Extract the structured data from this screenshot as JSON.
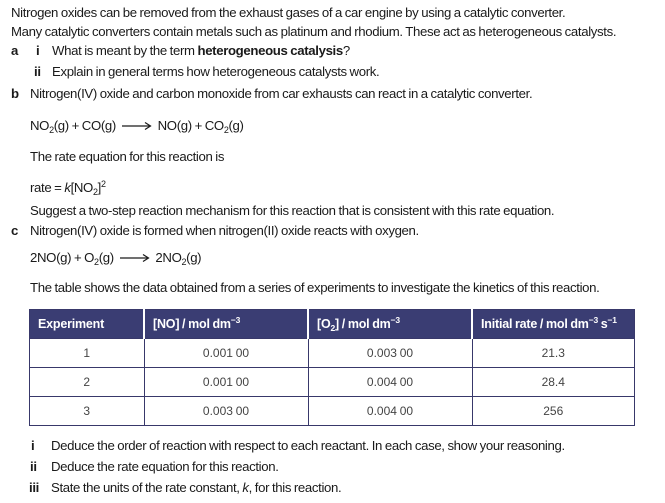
{
  "intro": {
    "line1": "Nitrogen oxides can be removed from the exhaust gases of a car engine by using a catalytic converter.",
    "line2": "Many catalytic converters contain metals such as platinum and rhodium. These act as heterogeneous catalysts."
  },
  "part_a": {
    "label": "a",
    "sub_i": {
      "label": "i",
      "text_before": "What is meant by the term ",
      "text_bold": "heterogeneous catalysis",
      "text_after": "?"
    },
    "sub_ii": {
      "label": "ii",
      "text": "Explain in general terms how heterogeneous catalysts work."
    }
  },
  "part_b": {
    "label": "b",
    "text": "Nitrogen(IV) oxide and carbon monoxide from car exhausts can react in a catalytic converter.",
    "equation": {
      "r1_a": "NO",
      "r1_sub": "2",
      "r1_b": "(g) + CO(g)",
      "p_a": "NO(g) + CO",
      "p_sub": "2",
      "p_b": "(g)"
    },
    "rate_intro": "The rate equation for this reaction is",
    "rate_eq": {
      "prefix": "rate = ",
      "k": "k",
      "bracket_open": "[NO",
      "sub": "2",
      "bracket_close": "]",
      "sup": "2"
    },
    "question": "Suggest a two-step reaction mechanism for this reaction that is consistent with this rate equation."
  },
  "part_c": {
    "label": "c",
    "text": "Nitrogen(IV) oxide is formed when nitrogen(II) oxide reacts with oxygen.",
    "equation": {
      "r_a": "2NO(g) + O",
      "r_sub": "2",
      "r_b": "(g)",
      "p_a": "2NO",
      "p_sub": "2",
      "p_b": "(g)"
    },
    "table_intro": "The table shows the data obtained from a series of experiments to investigate the kinetics of this reaction.",
    "table": {
      "headers": {
        "experiment": "Experiment",
        "no_a": "[NO] / mol dm",
        "no_sup": "−3",
        "o2_a": "[O",
        "o2_sub": "2",
        "o2_b": "] / mol dm",
        "o2_sup": "−3",
        "rate_a": "Initial rate / mol  dm",
        "rate_sup1": "−3",
        "rate_b": " s",
        "rate_sup2": "−1"
      },
      "rows": [
        {
          "experiment": "1",
          "no": "0.001 00",
          "o2": "0.003 00",
          "rate": "21.3"
        },
        {
          "experiment": "2",
          "no": "0.001 00",
          "o2": "0.004 00",
          "rate": "28.4"
        },
        {
          "experiment": "3",
          "no": "0.003 00",
          "o2": "0.004 00",
          "rate": "256"
        }
      ]
    },
    "sub_i": {
      "label": "i",
      "text": "Deduce the order of reaction with respect to each reactant. In each case, show your reasoning."
    },
    "sub_ii": {
      "label": "ii",
      "text": "Deduce the rate equation for this reaction."
    },
    "sub_iii": {
      "label": "iii",
      "text_before": "State the units of the rate constant, ",
      "k": "k",
      "text_after": ", for this reaction."
    }
  },
  "colors": {
    "table_header_bg": "#3a3d73",
    "table_border": "#38386a",
    "text": "#1a1a1a"
  }
}
